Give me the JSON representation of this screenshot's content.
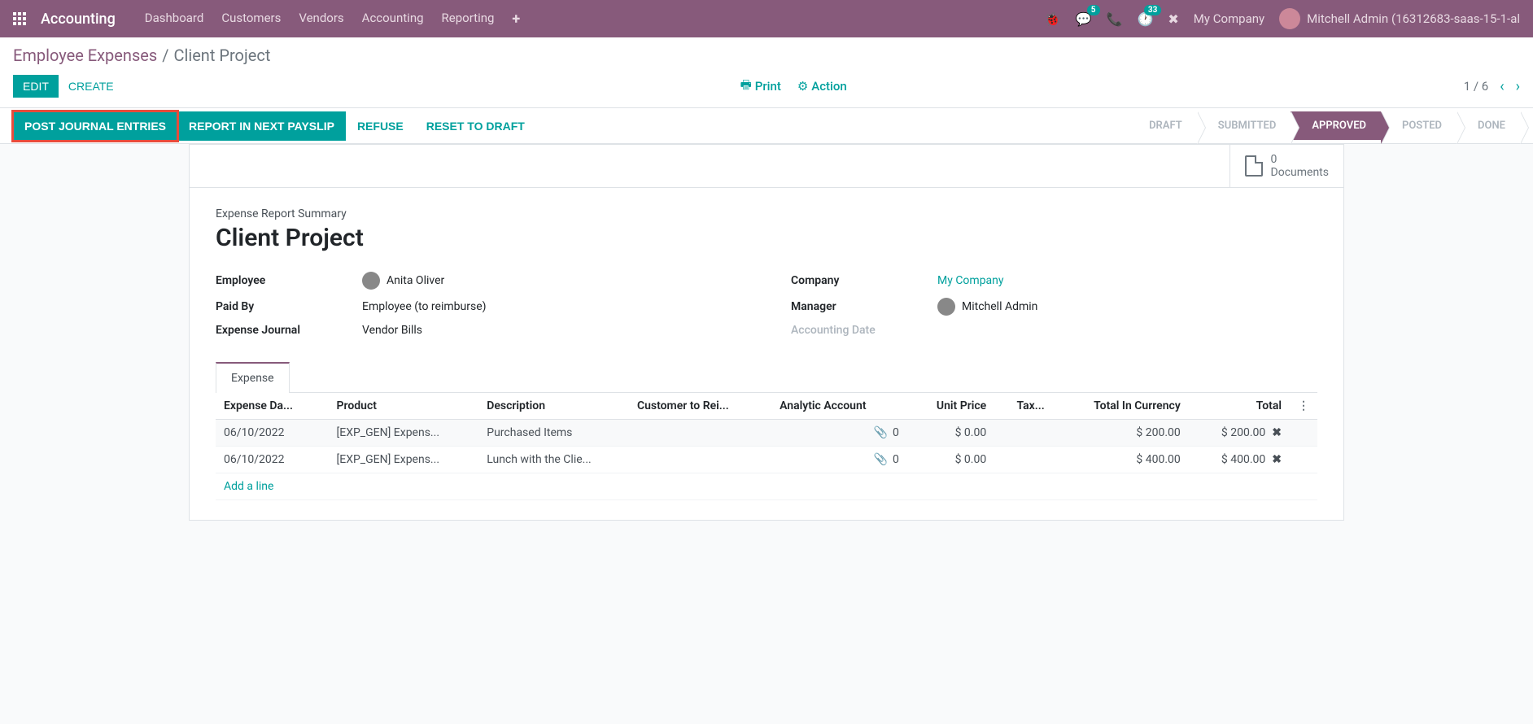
{
  "navbar": {
    "app_title": "Accounting",
    "menu": [
      "Dashboard",
      "Customers",
      "Vendors",
      "Accounting",
      "Reporting"
    ],
    "messages_badge": "5",
    "activities_badge": "33",
    "company": "My Company",
    "user": "Mitchell Admin (16312683-saas-15-1-al"
  },
  "breadcrumb": {
    "parent": "Employee Expenses",
    "current": "Client Project"
  },
  "controls": {
    "edit": "EDIT",
    "create": "CREATE",
    "print": "Print",
    "action": "Action",
    "pager": "1 / 6"
  },
  "status_buttons": {
    "post_journal": "POST JOURNAL ENTRIES",
    "report_payslip": "REPORT IN NEXT PAYSLIP",
    "refuse": "REFUSE",
    "reset_draft": "RESET TO DRAFT"
  },
  "stages": {
    "draft": "DRAFT",
    "submitted": "SUBMITTED",
    "approved": "APPROVED",
    "posted": "POSTED",
    "done": "DONE"
  },
  "documents": {
    "count": "0",
    "label": "Documents"
  },
  "summary": {
    "label": "Expense Report Summary",
    "title": "Client Project"
  },
  "fields": {
    "employee_label": "Employee",
    "employee": "Anita Oliver",
    "paid_by_label": "Paid By",
    "paid_by": "Employee (to reimburse)",
    "journal_label": "Expense Journal",
    "journal": "Vendor Bills",
    "company_label": "Company",
    "company": "My Company",
    "manager_label": "Manager",
    "manager": "Mitchell Admin",
    "accounting_date_label": "Accounting Date"
  },
  "tab": {
    "expense": "Expense"
  },
  "table": {
    "headers": {
      "date": "Expense Da...",
      "product": "Product",
      "description": "Description",
      "customer": "Customer to Rei...",
      "analytic": "Analytic Account",
      "unit_price": "Unit Price",
      "taxes": "Tax...",
      "total_currency": "Total In Currency",
      "total": "Total"
    },
    "rows": [
      {
        "date": "06/10/2022",
        "product": "[EXP_GEN] Expens...",
        "description": "Purchased Items",
        "analytic_count": "0",
        "unit_price": "$ 0.00",
        "total_currency": "$ 200.00",
        "total": "$ 200.00"
      },
      {
        "date": "06/10/2022",
        "product": "[EXP_GEN] Expens...",
        "description": "Lunch with the Clie...",
        "analytic_count": "0",
        "unit_price": "$ 0.00",
        "total_currency": "$ 400.00",
        "total": "$ 400.00"
      }
    ],
    "add_line": "Add a line"
  }
}
